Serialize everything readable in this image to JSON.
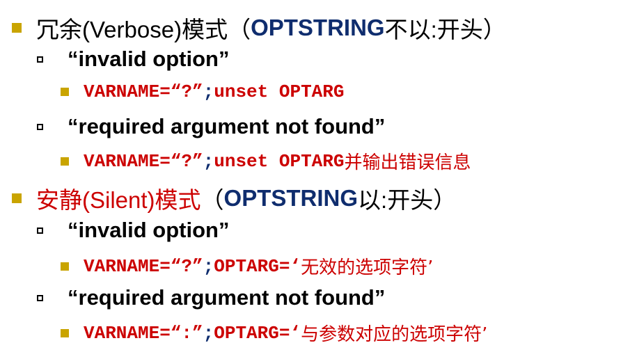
{
  "slide": {
    "verbose": {
      "title": "冗余(Verbose)模式",
      "open_paren": "（ ",
      "optstring": "OPTSTRING",
      "rule": " 不以:开头）",
      "cases": [
        {
          "label": "“invalid option”",
          "code_red": "VARNAME=“?”",
          "semicolon": " ; ",
          "code_red2": "unset OPTARG",
          "note": ""
        },
        {
          "label": "“required argument not found”",
          "code_red": "VARNAME=“?”",
          "semicolon": " ; ",
          "code_red2": "unset OPTARG",
          "note": " 并输出错误信息"
        }
      ]
    },
    "silent": {
      "title": "安静(Silent)模式",
      "open_paren": "（ ",
      "optstring": "OPTSTRING",
      "rule": " 以:开头）",
      "cases": [
        {
          "label": "“invalid option”",
          "code_red": "VARNAME=“?”",
          "semicolon": " ; ",
          "code_red2": "OPTARG=‘",
          "note": "无效的选项字符’"
        },
        {
          "label": "“required argument not found”",
          "code_red": "VARNAME=“:”",
          "semicolon": " ; ",
          "code_red2": "OPTARG=‘",
          "note": "与参数对应的选项字符’"
        }
      ]
    }
  },
  "colors": {
    "bullet_gold": "#c9a400",
    "navy": "#0f2d6e",
    "red": "#cc0000"
  }
}
